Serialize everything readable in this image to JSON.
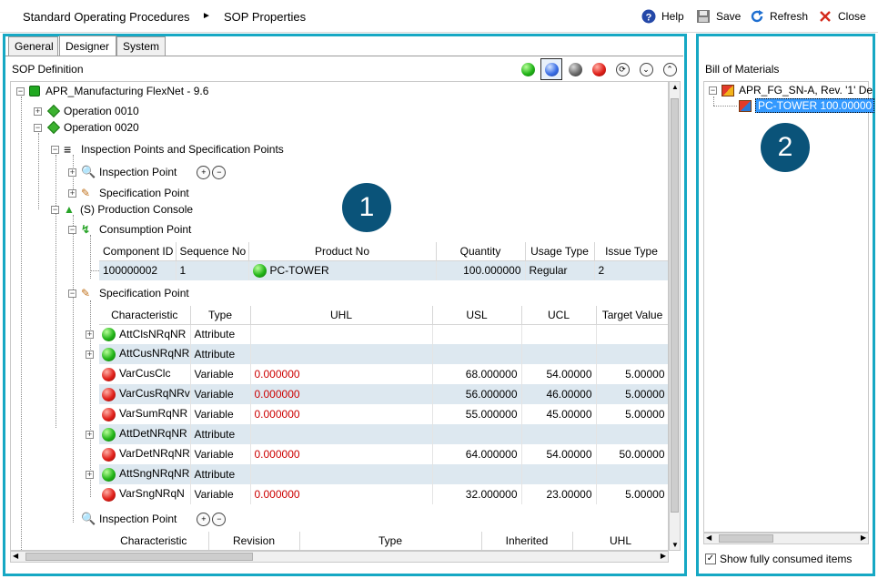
{
  "header": {
    "breadcrumb": [
      "Standard Operating Procedures",
      "SOP Properties"
    ],
    "separator": "►",
    "buttons": [
      {
        "label": "Help",
        "icon": "help-icon"
      },
      {
        "label": "Save",
        "icon": "save-icon"
      },
      {
        "label": "Refresh",
        "icon": "refresh-icon"
      },
      {
        "label": "Close",
        "icon": "close-icon"
      }
    ]
  },
  "tabs": [
    "General",
    "Designer",
    "System"
  ],
  "active_tab": "Designer",
  "sop_definition": {
    "label": "SOP Definition",
    "root": "APR_Manufacturing FlexNet - 9.6",
    "operation_1": "Operation 0010",
    "operation_2": "Operation 0020",
    "insp_spec_points": "Inspection Points and Specification Points",
    "inspection_point": "Inspection Point",
    "specification_point": "Specification Point",
    "production_console": "(S) Production Console",
    "consumption_point": "Consumption Point",
    "specification_point_2": "Specification Point",
    "inspection_point_2": "Inspection Point"
  },
  "consumption_table": {
    "columns": [
      "Component ID",
      "Sequence No",
      "Product No",
      "Quantity",
      "Usage Type",
      "Issue Type"
    ],
    "rows": [
      {
        "component_id": "100000002",
        "sequence_no": "1",
        "product_no": "PC-TOWER",
        "quantity": "100.000000",
        "usage_type": "Regular",
        "issue_type": "2"
      }
    ]
  },
  "spec_table": {
    "columns": [
      "Characteristic",
      "Type",
      "UHL",
      "USL",
      "UCL",
      "Target Value"
    ],
    "rows": [
      {
        "name": "AttClsNRqNR",
        "status": "green",
        "type": "Attribute",
        "uhl": "",
        "usl": "",
        "ucl": "",
        "target": "",
        "expand": true
      },
      {
        "name": "AttCusNRqNR",
        "status": "green",
        "type": "Attribute",
        "uhl": "",
        "usl": "",
        "ucl": "",
        "target": "",
        "expand": true
      },
      {
        "name": "VarCusClc",
        "status": "red",
        "type": "Variable",
        "uhl": "0.000000",
        "usl": "68.000000",
        "ucl": "54.00000",
        "target": "5.00000",
        "expand": false
      },
      {
        "name": "VarCusRqNRv",
        "status": "red",
        "type": "Variable",
        "uhl": "0.000000",
        "usl": "56.000000",
        "ucl": "46.00000",
        "target": "5.00000",
        "expand": false
      },
      {
        "name": "VarSumRqNR",
        "status": "red",
        "type": "Variable",
        "uhl": "0.000000",
        "usl": "55.000000",
        "ucl": "45.00000",
        "target": "5.00000",
        "expand": false
      },
      {
        "name": "AttDetNRqNR",
        "status": "green",
        "type": "Attribute",
        "uhl": "",
        "usl": "",
        "ucl": "",
        "target": "",
        "expand": true
      },
      {
        "name": "VarDetNRqNR",
        "status": "red",
        "type": "Variable",
        "uhl": "0.000000",
        "usl": "64.000000",
        "ucl": "54.00000",
        "target": "50.00000",
        "expand": false
      },
      {
        "name": "AttSngNRqNR",
        "status": "green",
        "type": "Attribute",
        "uhl": "",
        "usl": "",
        "ucl": "",
        "target": "",
        "expand": true
      },
      {
        "name": "VarSngNRqN",
        "status": "red",
        "type": "Variable",
        "uhl": "0.000000",
        "usl": "32.000000",
        "ucl": "23.00000",
        "target": "5.00000",
        "expand": false
      }
    ]
  },
  "inspection_table": {
    "columns": [
      "Characteristic",
      "Revision",
      "Type",
      "Inherited",
      "UHL"
    ]
  },
  "bom": {
    "label": "Bill of Materials",
    "root": "APR_FG_SN-A, Rev. '1' De",
    "child": "PC-TOWER 100.00000",
    "show_consumed_label": "Show fully consumed items",
    "show_consumed_checked": true
  },
  "callouts": [
    "1",
    "2"
  ],
  "colors": {
    "frame": "#16a8c4",
    "callout": "#0a5379",
    "selected": "#3399ff"
  }
}
